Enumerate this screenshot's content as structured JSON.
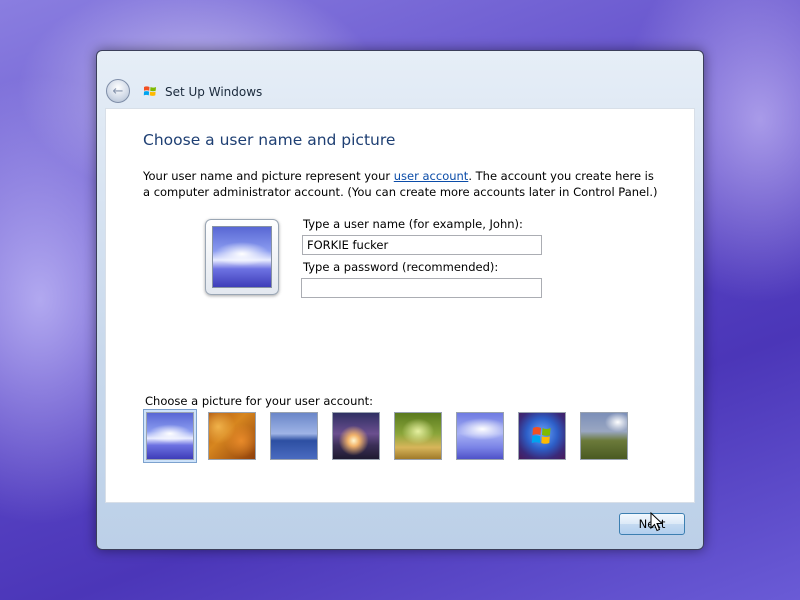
{
  "window": {
    "title": "Set Up Windows"
  },
  "page": {
    "heading": "Choose a user name and picture",
    "description_before": "Your user name and picture represent your ",
    "description_link": "user account",
    "description_after": ". The account you create here is a computer administrator account. (You can create more accounts later in Control Panel.)"
  },
  "form": {
    "username_label": "Type a user name (for example, John):",
    "username_value": "FORKIE fucker",
    "password_label": "Type a password (recommended):",
    "password_value": ""
  },
  "pictures": {
    "label": "Choose a picture for your user account:",
    "selected_index": 0,
    "items": [
      "sky-clouds",
      "autumn-leaves",
      "lake",
      "sunset",
      "forest",
      "sky",
      "windows-logo",
      "field"
    ]
  },
  "footer": {
    "next_label": "Next"
  },
  "icons": {
    "back": "back-arrow-icon",
    "logo": "windows-flag-icon",
    "cursor": "mouse-pointer-icon"
  },
  "colors": {
    "heading": "#1e3f73",
    "link": "#0b4ca8",
    "window_frame": "#c9d9ec"
  }
}
